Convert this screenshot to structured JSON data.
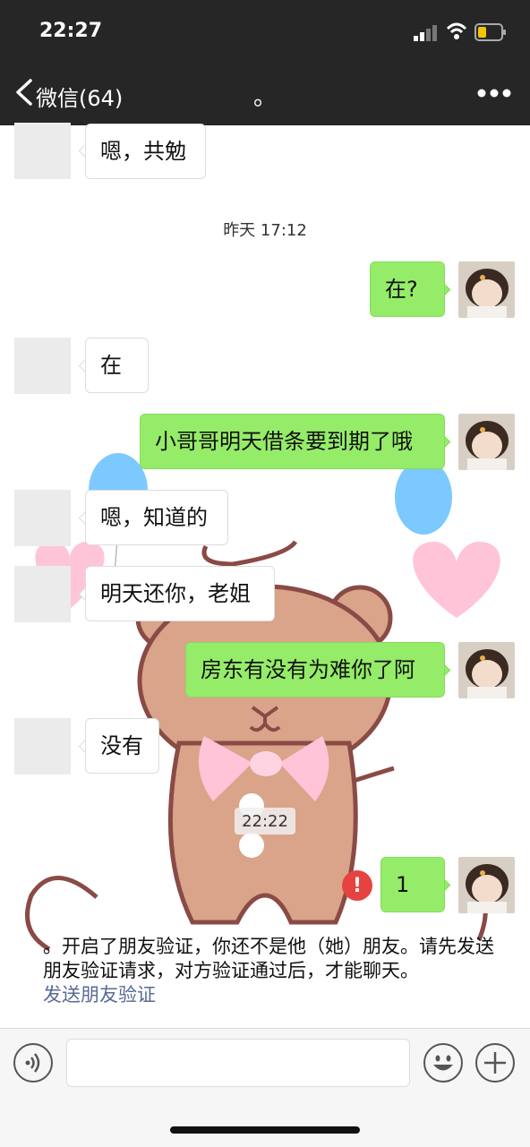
{
  "status_bar": {
    "time": "22:27"
  },
  "nav": {
    "back_label": "微信(64)",
    "title": "。"
  },
  "messages": [
    {
      "side": "in",
      "text": "嗯，共勉"
    },
    {
      "side": "in",
      "text": "在"
    },
    {
      "side": "in",
      "text": "嗯，知道的"
    },
    {
      "side": "in",
      "text": "明天还你，老姐"
    },
    {
      "side": "in",
      "text": "没有"
    },
    {
      "side": "out",
      "text": "在?"
    },
    {
      "side": "out",
      "text": "小哥哥明天借条要到期了哦"
    },
    {
      "side": "out",
      "text": "房东有没有为难你了阿"
    },
    {
      "side": "out",
      "text": "1",
      "status": "failed"
    }
  ],
  "timestamps": {
    "t1": "昨天 17:12",
    "t2": "22:22"
  },
  "error_mark": "!",
  "notice": {
    "text": "。开启了朋友验证，你还不是他（她）朋友。请先发送朋友验证请求，对方验证通过后，才能聊天。",
    "link": "发送朋友验证"
  },
  "icons": {
    "back": "chevron-left-icon",
    "more": "more-dots-icon",
    "voice": "voice-icon",
    "emoji": "emoji-icon",
    "plus": "plus-icon",
    "error": "error-icon"
  },
  "colors": {
    "bubble_out": "#95ec69",
    "bubble_in": "#ffffff",
    "link": "#576b95",
    "error": "#e64340",
    "nav_bg": "#262626"
  }
}
